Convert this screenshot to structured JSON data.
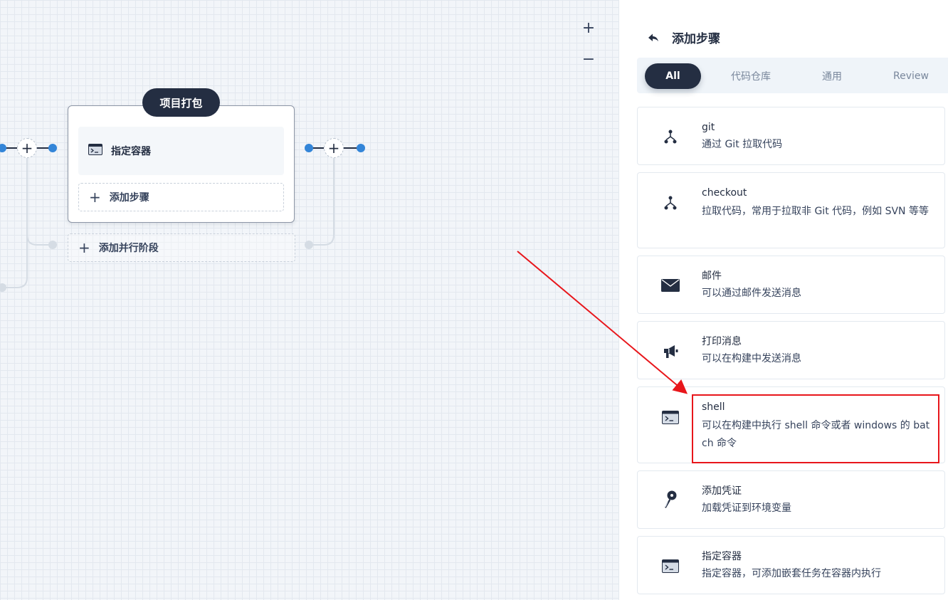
{
  "canvas": {
    "zoom_in_label": "+",
    "zoom_out_label": "−",
    "stage": {
      "title": "项目打包",
      "step_label": "指定容器",
      "add_step_label": "添加步骤"
    },
    "add_parallel_label": "添加并行阶段",
    "node_plus": "+"
  },
  "panel": {
    "title": "添加步骤",
    "tabs": [
      {
        "label": "All",
        "active": true
      },
      {
        "label": "代码仓库",
        "active": false
      },
      {
        "label": "通用",
        "active": false
      },
      {
        "label": "Review",
        "active": false
      }
    ],
    "steps": [
      {
        "name": "git",
        "desc": "通过 Git 拉取代码",
        "icon": "git-branch-icon"
      },
      {
        "name": "checkout",
        "desc": "拉取代码，常用于拉取非 Git 代码，例如 SVN 等等",
        "icon": "git-branch-icon"
      },
      {
        "name": "邮件",
        "desc": "可以通过邮件发送消息",
        "icon": "mail-icon"
      },
      {
        "name": "打印消息",
        "desc": "可以在构建中发送消息",
        "icon": "megaphone-icon"
      },
      {
        "name": "shell",
        "desc": "可以在构建中执行 shell 命令或者 windows 的 batch 命令",
        "icon": "terminal-icon"
      },
      {
        "name": "添加凭证",
        "desc": "加载凭证到环境变量",
        "icon": "key-icon"
      },
      {
        "name": "指定容器",
        "desc": "指定容器，可添加嵌套任务在容器内执行",
        "icon": "terminal-icon"
      }
    ]
  },
  "colors": {
    "dark": "#242e42",
    "accent_blue": "#3385d8",
    "highlight_red": "#e8161b"
  }
}
